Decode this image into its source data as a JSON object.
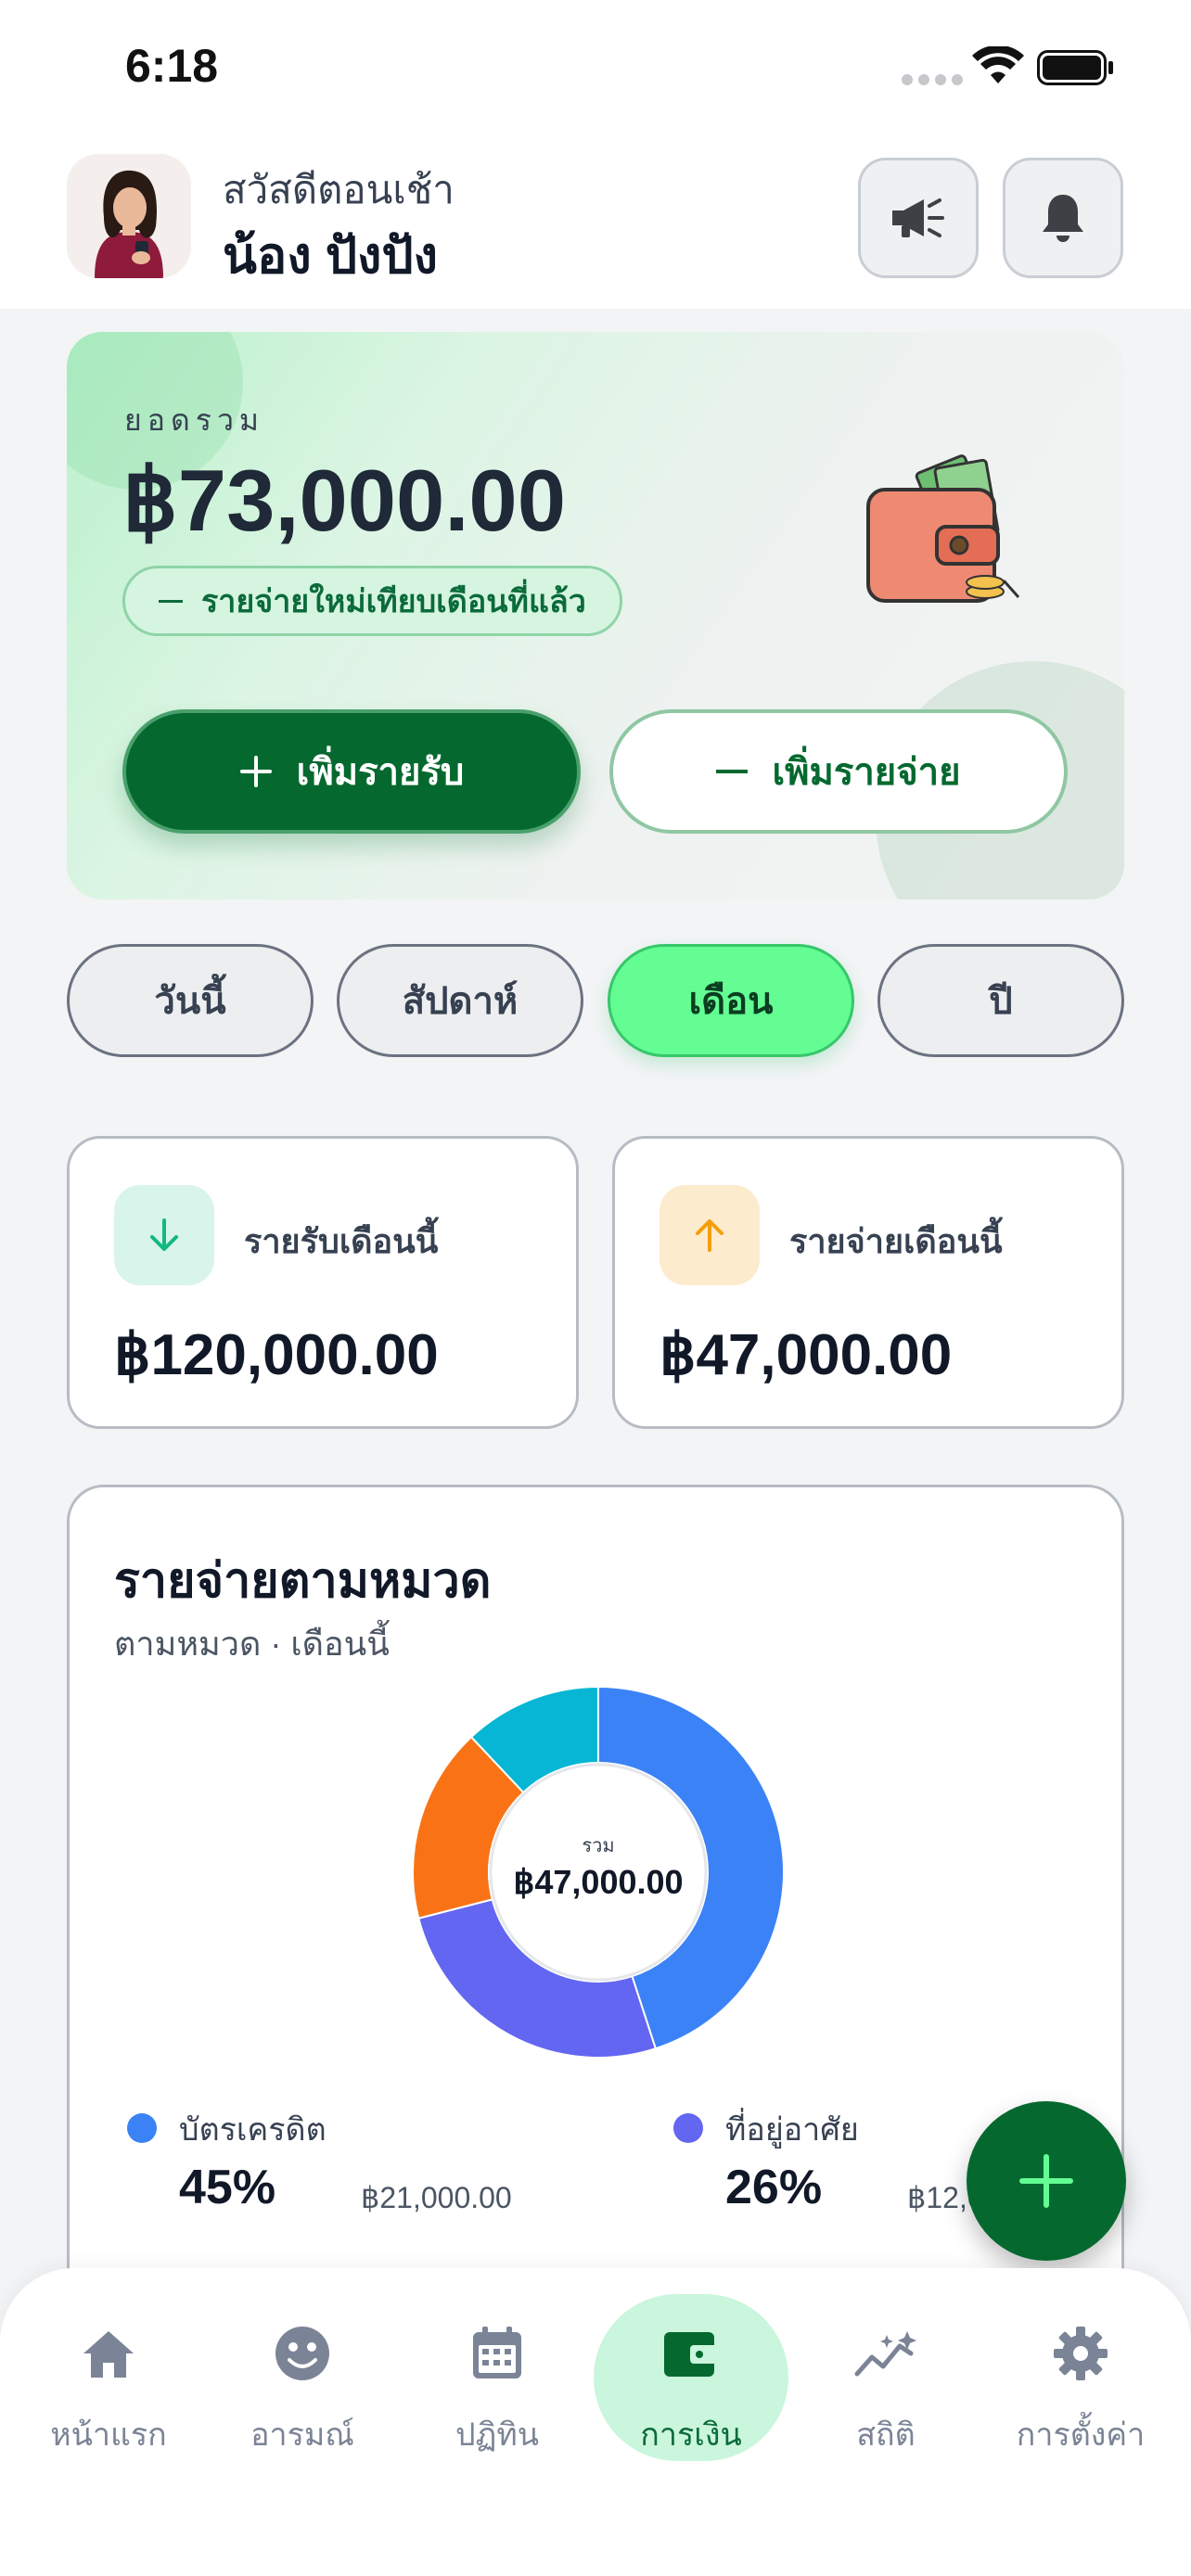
{
  "status_bar": {
    "time": "6:18"
  },
  "header": {
    "greeting": "สวัสดีตอนเช้า",
    "user_name": "น้อง ปังปัง",
    "icons": [
      "megaphone-icon",
      "bell-icon"
    ]
  },
  "balance": {
    "label": "ยอดรวม",
    "amount": "฿73,000.00",
    "comparison": "รายจ่ายใหม่เทียบเดือนที่แล้ว",
    "add_income": "เพิ่มรายรับ",
    "add_expense": "เพิ่มรายจ่าย"
  },
  "period_tabs": {
    "selected": "เดือน",
    "items": [
      "วันนี้",
      "สัปดาห์",
      "เดือน",
      "ปี"
    ]
  },
  "summary": {
    "income": {
      "label": "รายรับเดือนนี้",
      "amount": "฿120,000.00",
      "color": "#10b981"
    },
    "expense": {
      "label": "รายจ่ายเดือนนี้",
      "amount": "฿47,000.00",
      "color": "#f59e0b"
    }
  },
  "category": {
    "title": "รายจ่ายตามหมวด",
    "subtitle": "ตามหมวด · เดือนนี้",
    "center_label": "รวม",
    "center_amount": "฿47,000.00",
    "legend": [
      {
        "name": "บัตรเครดิต",
        "percent": "45%",
        "amount": "฿21,000.00",
        "color": "#3b82f6"
      },
      {
        "name": "ที่อยู่อาศัย",
        "percent": "26%",
        "amount": "฿12,000.00",
        "color": "#6366f1"
      }
    ]
  },
  "chart_data": {
    "type": "pie",
    "categories": [
      "บัตรเครดิต",
      "ที่อยู่อาศัย",
      "",
      ""
    ],
    "values": [
      45,
      26,
      17,
      12
    ],
    "colors": [
      "#3b82f6",
      "#6366f1",
      "#f97316",
      "#06b6d4"
    ]
  },
  "nav": {
    "selected": "การเงิน",
    "items": [
      {
        "label": "หน้าแรก",
        "icon": "home-icon"
      },
      {
        "label": "อารมณ์",
        "icon": "smiley-icon"
      },
      {
        "label": "ปฏิทิน",
        "icon": "calendar-icon"
      },
      {
        "label": "การเงิน",
        "icon": "wallet-icon"
      },
      {
        "label": "สถิติ",
        "icon": "sparkline-icon"
      },
      {
        "label": "การตั้งค่า",
        "icon": "gear-icon"
      }
    ]
  },
  "colors": {
    "brand_green": "#05692f",
    "accent_green": "#63fd94"
  }
}
